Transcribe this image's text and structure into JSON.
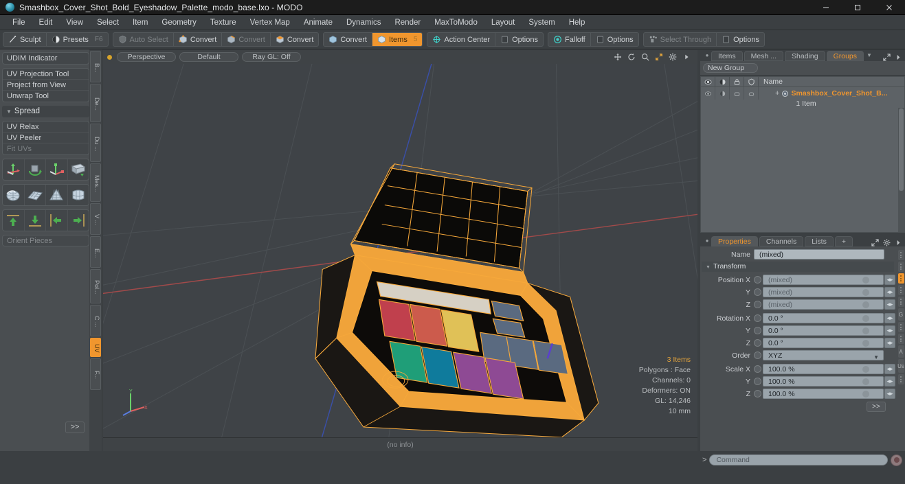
{
  "window": {
    "title": "Smashbox_Cover_Shot_Bold_Eyeshadow_Palette_modo_base.lxo - MODO",
    "app_icon": "modo-sphere-icon",
    "controls": {
      "minimize": "minimize-icon",
      "maximize": "maximize-icon",
      "close": "close-icon"
    }
  },
  "menubar": {
    "items": [
      {
        "label": "File"
      },
      {
        "label": "Edit"
      },
      {
        "label": "View"
      },
      {
        "label": "Select"
      },
      {
        "label": "Item"
      },
      {
        "label": "Geometry"
      },
      {
        "label": "Texture"
      },
      {
        "label": "Vertex Map"
      },
      {
        "label": "Animate"
      },
      {
        "label": "Dynamics"
      },
      {
        "label": "Render"
      },
      {
        "label": "MaxToModo"
      },
      {
        "label": "Layout"
      },
      {
        "label": "System"
      },
      {
        "label": "Help"
      }
    ]
  },
  "toolbar": {
    "groups": [
      {
        "buttons": [
          {
            "label": "Sculpt",
            "icon": "brush-icon",
            "state": "normal",
            "key": ""
          },
          {
            "label": "Presets",
            "icon": "sphere-half-icon",
            "state": "normal",
            "key": "F6"
          }
        ]
      },
      {
        "buttons": [
          {
            "label": "Auto Select",
            "icon": "shield-icon",
            "state": "dim",
            "key": ""
          },
          {
            "label": "Convert",
            "icon": "cube-vertex-icon",
            "state": "normal",
            "key": ""
          },
          {
            "label": "Convert",
            "icon": "cube-edge-icon",
            "state": "dim",
            "key": ""
          },
          {
            "label": "Convert",
            "icon": "cube-polygon-icon",
            "state": "normal",
            "key": ""
          }
        ]
      },
      {
        "buttons": [
          {
            "label": "Convert",
            "icon": "cube-material-icon",
            "state": "normal",
            "key": ""
          },
          {
            "label": "Items",
            "icon": "cube-items-icon",
            "state": "active",
            "key": "5"
          }
        ]
      },
      {
        "buttons": [
          {
            "label": "Action Center",
            "icon": "action-center-icon",
            "state": "normal",
            "key": ""
          },
          {
            "label": "Options",
            "icon": "options-box-icon",
            "state": "normal",
            "key": ""
          }
        ]
      },
      {
        "buttons": [
          {
            "label": "Falloff",
            "icon": "falloff-icon",
            "state": "normal",
            "key": ""
          },
          {
            "label": "Options",
            "icon": "options-box-icon",
            "state": "normal",
            "key": ""
          }
        ]
      },
      {
        "buttons": [
          {
            "label": "Select Through",
            "icon": "select-through-icon",
            "state": "dim",
            "key": ""
          },
          {
            "label": "Options",
            "icon": "options-box-icon",
            "state": "normal",
            "key": ""
          }
        ]
      }
    ]
  },
  "left_panel": {
    "group1": [
      {
        "label": "UDIM Indicator",
        "dim": false
      }
    ],
    "group2": [
      {
        "label": "UV Projection Tool",
        "dim": false
      },
      {
        "label": "Project from View",
        "dim": false
      },
      {
        "label": "Unwrap Tool",
        "dim": false
      }
    ],
    "section": {
      "label": "Spread"
    },
    "group3": [
      {
        "label": "UV Relax",
        "dim": false
      },
      {
        "label": "UV Peeler",
        "dim": false
      },
      {
        "label": "Fit UVs",
        "dim": true
      }
    ],
    "icon_rows": [
      [
        "move-uv-icon",
        "rotate-uv-icon",
        "scale-uv-icon",
        "flip-uv-icon"
      ],
      [
        "uv-sphere-icon",
        "uv-grid-icon",
        "uv-cone-icon",
        "uv-cylinder-icon"
      ],
      [
        "align-up-icon",
        "align-down-icon",
        "align-left-icon",
        "align-right-icon"
      ]
    ],
    "orient_field": {
      "placeholder": "Orient Pieces",
      "value": ""
    },
    "more_button": ">>",
    "vtabs": [
      {
        "label": "B...",
        "active": false
      },
      {
        "label": "De...",
        "active": false
      },
      {
        "label": "Du ...",
        "active": false
      },
      {
        "label": "Mes...",
        "active": false
      },
      {
        "label": "V ...",
        "active": false
      },
      {
        "label": "E...",
        "active": false
      },
      {
        "label": "Pol...",
        "active": false
      },
      {
        "label": "C ...",
        "active": false
      },
      {
        "label": "UV",
        "active": true
      },
      {
        "label": "F...",
        "active": false
      }
    ]
  },
  "viewport": {
    "header": {
      "view_mode": "Perspective",
      "shading": "Default",
      "raygl": "Ray GL: Off",
      "icons": [
        "pan-icon",
        "rotate-icon",
        "zoom-icon",
        "fit-icon",
        "gear-icon",
        "chevron-right-icon"
      ]
    },
    "info": {
      "items": "3 Items",
      "polygons": "Polygons : Face",
      "channels": "Channels: 0",
      "deformers": "Deformers: ON",
      "gl": "GL: 14,246",
      "scale": "10 mm"
    },
    "status": "(no info)",
    "model": {
      "name": "eyeshadow-palette-wireframe",
      "wire_color": "#f7a93b",
      "pan_colors": [
        "#d6d0c4",
        "#c0404d",
        "#cc5b4c",
        "#e0c157",
        "#1f9e78",
        "#0f7b9c",
        "#8e4a94",
        "#5a6a80"
      ]
    }
  },
  "right_panel": {
    "top_tabs": [
      {
        "label": "Items",
        "active": false
      },
      {
        "label": "Mesh ...",
        "active": false
      },
      {
        "label": "Shading",
        "active": false
      },
      {
        "label": "Groups",
        "active": true
      }
    ],
    "new_group_button": "New Group",
    "item_list": {
      "columns": [
        "eye-icon",
        "render-icon",
        "lock-icon",
        "shield-icon"
      ],
      "name_header": "Name",
      "rows": [
        {
          "label": "Smashbox_Cover_Shot_B...",
          "sub": "1 Item",
          "icon": "group-icon"
        }
      ]
    },
    "properties": {
      "tabs": [
        {
          "label": "Properties",
          "active": true
        },
        {
          "label": "Channels",
          "active": false
        },
        {
          "label": "Lists",
          "active": false
        },
        {
          "label": "+",
          "active": false
        }
      ],
      "name_label": "Name",
      "name_value": "(mixed)",
      "section": "Transform",
      "fields": [
        {
          "label": "Position X",
          "value": "(mixed)",
          "dim": true
        },
        {
          "label": "Y",
          "value": "(mixed)",
          "dim": true
        },
        {
          "label": "Z",
          "value": "(mixed)",
          "dim": true
        },
        {
          "label": "Rotation X",
          "value": "0.0 °",
          "dim": false
        },
        {
          "label": "Y",
          "value": "0.0 °",
          "dim": false
        },
        {
          "label": "Z",
          "value": "0.0 °",
          "dim": false
        },
        {
          "label": "Order",
          "value": "XYZ",
          "dim": false,
          "dropdown": true
        },
        {
          "label": "Scale X",
          "value": "100.0 %",
          "dim": false
        },
        {
          "label": "Y",
          "value": "100.0 %",
          "dim": false
        },
        {
          "label": "Z",
          "value": "100.0 %",
          "dim": false
        }
      ],
      "more_button": ">>"
    },
    "gutter_tabs": [
      {
        "label": "",
        "active": false
      },
      {
        "label": "",
        "active": false
      },
      {
        "label": "",
        "active": true
      },
      {
        "label": "",
        "active": false
      },
      {
        "label": "",
        "active": false
      },
      {
        "label": "G",
        "active": false
      },
      {
        "label": "",
        "active": false
      },
      {
        "label": "",
        "active": false
      },
      {
        "label": "A",
        "active": false
      },
      {
        "label": "Us",
        "active": false
      },
      {
        "label": "",
        "active": false
      }
    ]
  },
  "bottom_bar": {
    "caret": ">",
    "command_placeholder": "Command",
    "record_icon": "record-icon"
  },
  "colors": {
    "accent": "#f0962e",
    "wire": "#f7a93b",
    "panel": "#4a4e51",
    "bg": "#3b3f42"
  }
}
